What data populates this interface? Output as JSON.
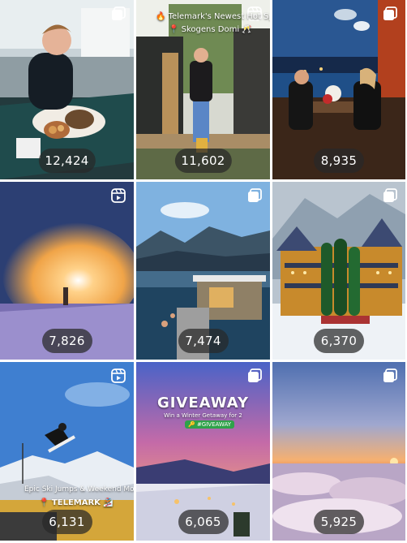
{
  "posts": [
    {
      "count": "12,424",
      "type": "carousel-icon"
    },
    {
      "count": "11,602",
      "type": "reel-icon",
      "caption_line1": "🔥 Telemark's Newest Hot Spot",
      "caption_line2": "📍 Skogens Domi 🥂"
    },
    {
      "count": "8,935",
      "type": "carousel-icon"
    },
    {
      "count": "7,826",
      "type": "reel-icon"
    },
    {
      "count": "7,474",
      "type": "carousel-icon"
    },
    {
      "count": "6,370",
      "type": "carousel-icon"
    },
    {
      "count": "6,131",
      "type": "reel-icon",
      "caption_line1": "Epic Ski Jumps & Weekend Mode: ON",
      "caption_line2": "📍 TELEMARK 🏂"
    },
    {
      "count": "6,065",
      "type": "carousel-icon",
      "title": "GIVEAWAY",
      "subtitle": "Win a Winter Getaway for 2",
      "tag": "🔑 #GIVEAWAY"
    },
    {
      "count": "5,925",
      "type": "carousel-icon"
    }
  ]
}
